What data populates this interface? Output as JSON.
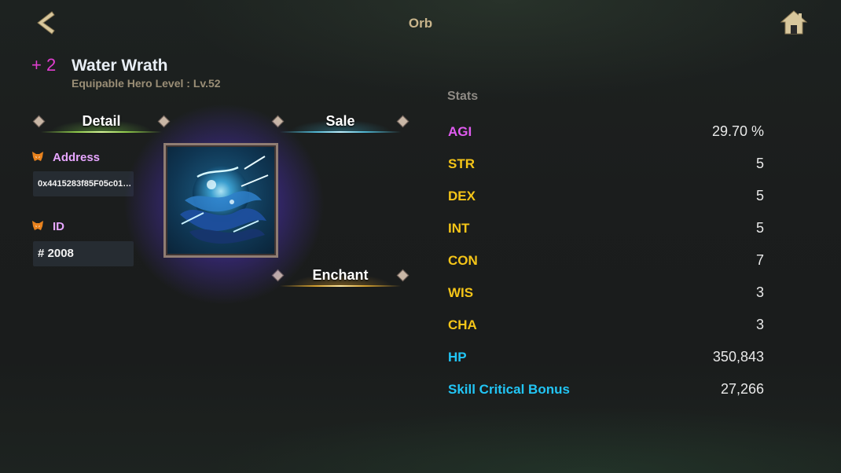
{
  "header": {
    "title": "Orb",
    "back_icon": "back-arrow-icon",
    "home_icon": "home-icon"
  },
  "item": {
    "enhance_level": "+ 2",
    "name": "Water Wrath",
    "equip_level_text": "Equipable Hero Level : Lv.52",
    "image_icon": "water-wrath-orb-art"
  },
  "tabs": {
    "detail": "Detail",
    "sale": "Sale",
    "enchant": "Enchant"
  },
  "info": {
    "address_label": "Address",
    "address_value": "0x4415283f85F05c01…",
    "id_label": "ID",
    "id_value": "# 2008",
    "fox_icon": "metamask-fox-icon"
  },
  "stats": {
    "title": "Stats",
    "rows": [
      {
        "name": "AGI",
        "value": "29.70 %",
        "color": "#e05bf0"
      },
      {
        "name": "STR",
        "value": "5",
        "color": "#f5c518"
      },
      {
        "name": "DEX",
        "value": "5",
        "color": "#f5c518"
      },
      {
        "name": "INT",
        "value": "5",
        "color": "#f5c518"
      },
      {
        "name": "CON",
        "value": "7",
        "color": "#f5c518"
      },
      {
        "name": "WIS",
        "value": "3",
        "color": "#f5c518"
      },
      {
        "name": "CHA",
        "value": "3",
        "color": "#f5c518"
      },
      {
        "name": "HP",
        "value": "350,843",
        "color": "#22c5f5"
      },
      {
        "name": "Skill Critical Bonus",
        "value": "27,266",
        "color": "#22c5f5"
      }
    ]
  },
  "colors": {
    "enhance": "#e03ed0",
    "field_label": "#e7a6ff",
    "title_gold": "#c9b58c"
  }
}
